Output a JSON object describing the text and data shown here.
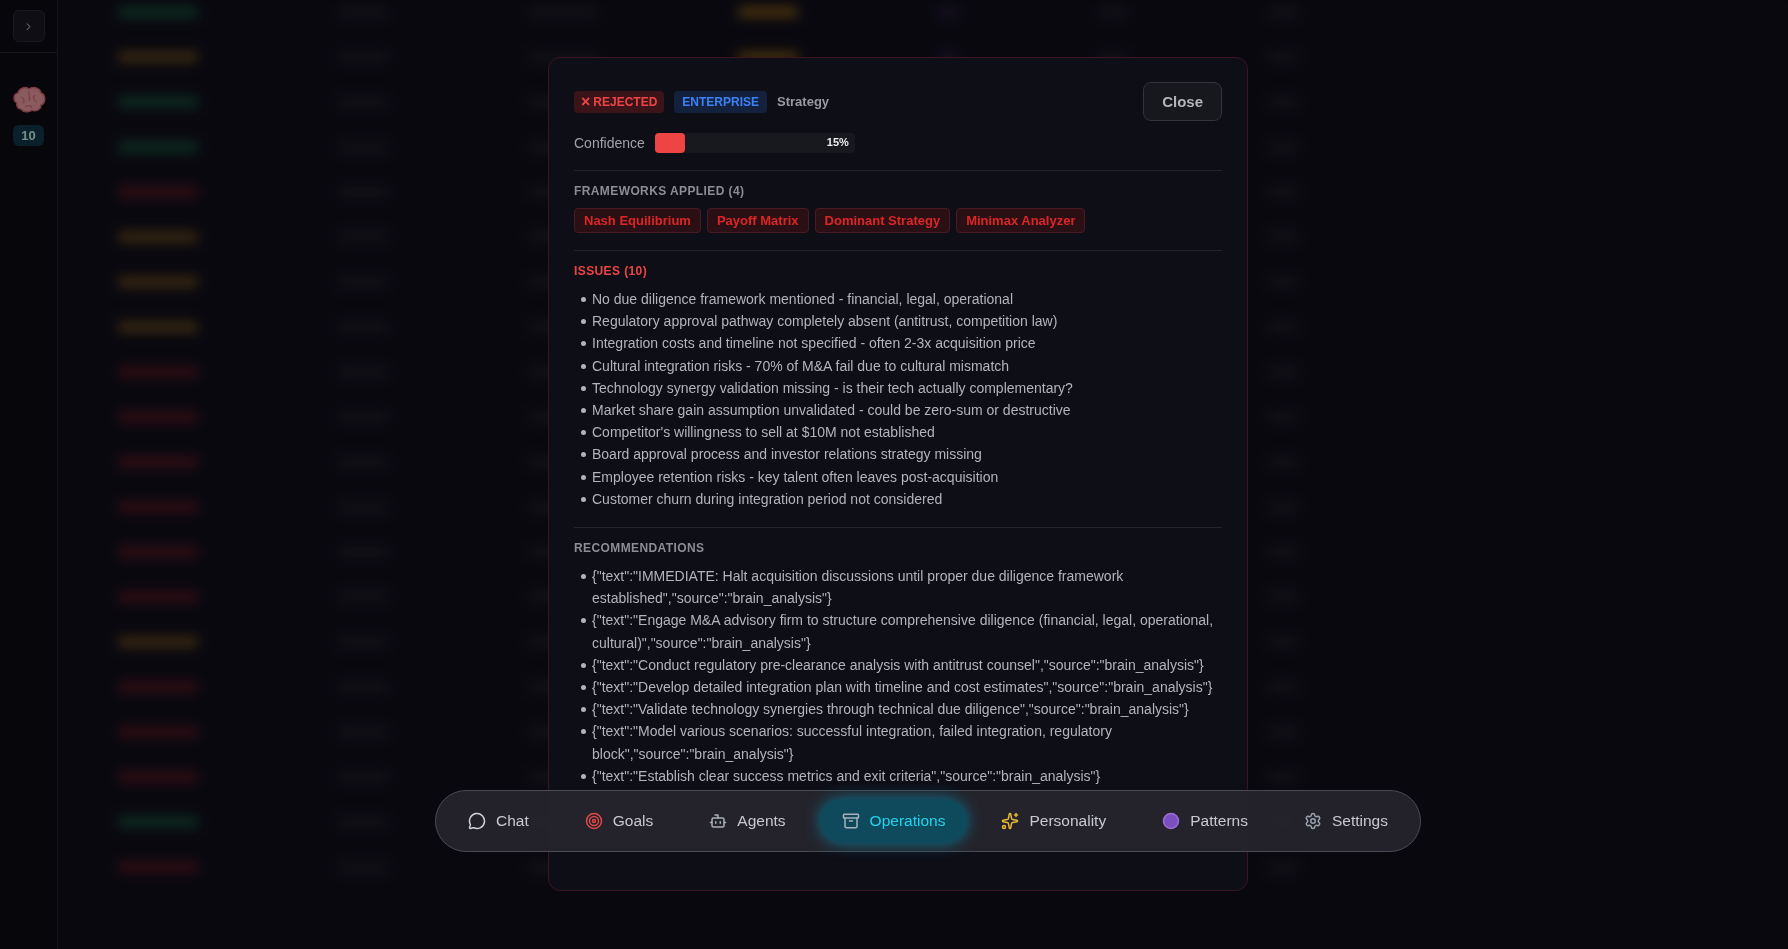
{
  "sidebar": {
    "toggle": "›",
    "count": "10"
  },
  "modal": {
    "status": {
      "label": "REJECTED",
      "icon": "×",
      "kind": "rejected"
    },
    "tier": "ENTERPRISE",
    "category": "Strategy",
    "close": "Close",
    "confidence": {
      "label": "Confidence",
      "level": 0.15,
      "reading": "15%"
    },
    "frameworks": {
      "title": "FRAMEWORKS APPLIED (4)",
      "items": [
        "Nash Equilibrium",
        "Payoff Matrix",
        "Dominant Strategy",
        "Minimax Analyzer"
      ]
    },
    "issues": {
      "title": "ISSUES (10)",
      "items": [
        "No due diligence framework mentioned - financial, legal, operational",
        "Regulatory approval pathway completely absent (antitrust, competition law)",
        "Integration costs and timeline not specified - often 2-3x acquisition price",
        "Cultural integration risks - 70% of M&A fail due to cultural mismatch",
        "Technology synergy validation missing - is their tech actually complementary?",
        "Market share gain assumption unvalidated - could be zero-sum or destructive",
        "Competitor's willingness to sell at $10M not established",
        "Board approval process and investor relations strategy missing",
        "Employee retention risks - key talent often leaves post-acquisition",
        "Customer churn during integration period not considered"
      ]
    },
    "recommendations": {
      "title": "RECOMMENDATIONS",
      "items": [
        "{\"text\":\"IMMEDIATE: Halt acquisition discussions until proper due diligence framework established\",\"source\":\"brain_analysis\"}",
        "{\"text\":\"Engage M&A advisory firm to structure comprehensive diligence (financial, legal, operational, cultural)\",\"source\":\"brain_analysis\"}",
        "{\"text\":\"Conduct regulatory pre-clearance analysis with antitrust counsel\",\"source\":\"brain_analysis\"}",
        "{\"text\":\"Develop detailed integration plan with timeline and cost estimates\",\"source\":\"brain_analysis\"}",
        "{\"text\":\"Validate technology synergies through technical due diligence\",\"source\":\"brain_analysis\"}",
        "{\"text\":\"Model various scenarios: successful integration, failed integration, regulatory block\",\"source\":\"brain_analysis\"}",
        "{\"text\":\"Establish clear success metrics and exit criteria\",\"source\":\"brain_analysis\"}"
      ]
    }
  },
  "nav": [
    {
      "label": "Chat",
      "kind": "chat",
      "selected": false
    },
    {
      "label": "Goals",
      "kind": "goals",
      "selected": false
    },
    {
      "label": "Agents",
      "kind": "agents",
      "selected": false
    },
    {
      "label": "Operations",
      "kind": "operations",
      "selected": true
    },
    {
      "label": "Personality",
      "kind": "personality",
      "selected": false
    },
    {
      "label": "Patterns",
      "kind": "patterns",
      "selected": false
    },
    {
      "label": "Settings",
      "kind": "settings",
      "selected": false
    }
  ]
}
